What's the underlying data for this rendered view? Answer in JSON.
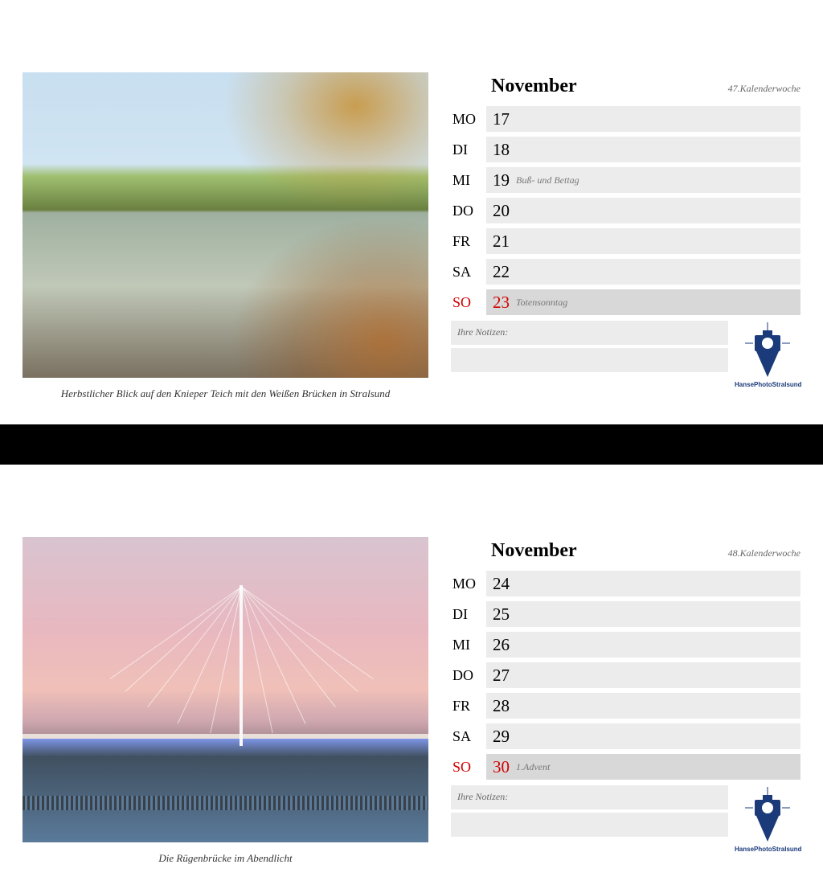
{
  "logo_label": "HansePhotoStralsund",
  "pages": [
    {
      "photo_caption": "Herbstlicher Blick auf den Knieper Teich mit den Weißen Brücken in Stralsund",
      "month": "November",
      "week_label": "47.Kalenderwoche",
      "notes_label": "Ihre Notizen:",
      "days": [
        {
          "abbrev": "MO",
          "num": "17",
          "note": "",
          "sunday": false
        },
        {
          "abbrev": "DI",
          "num": "18",
          "note": "",
          "sunday": false
        },
        {
          "abbrev": "MI",
          "num": "19",
          "note": "Buß- und Bettag",
          "sunday": false
        },
        {
          "abbrev": "DO",
          "num": "20",
          "note": "",
          "sunday": false
        },
        {
          "abbrev": "FR",
          "num": "21",
          "note": "",
          "sunday": false
        },
        {
          "abbrev": "SA",
          "num": "22",
          "note": "",
          "sunday": false
        },
        {
          "abbrev": "SO",
          "num": "23",
          "note": "Totensonntag",
          "sunday": true
        }
      ]
    },
    {
      "photo_caption": "Die Rügenbrücke im Abendlicht",
      "month": "November",
      "week_label": "48.Kalenderwoche",
      "notes_label": "Ihre Notizen:",
      "days": [
        {
          "abbrev": "MO",
          "num": "24",
          "note": "",
          "sunday": false
        },
        {
          "abbrev": "DI",
          "num": "25",
          "note": "",
          "sunday": false
        },
        {
          "abbrev": "MI",
          "num": "26",
          "note": "",
          "sunday": false
        },
        {
          "abbrev": "DO",
          "num": "27",
          "note": "",
          "sunday": false
        },
        {
          "abbrev": "FR",
          "num": "28",
          "note": "",
          "sunday": false
        },
        {
          "abbrev": "SA",
          "num": "29",
          "note": "",
          "sunday": false
        },
        {
          "abbrev": "SO",
          "num": "30",
          "note": "1.Advent",
          "sunday": true
        }
      ]
    }
  ]
}
